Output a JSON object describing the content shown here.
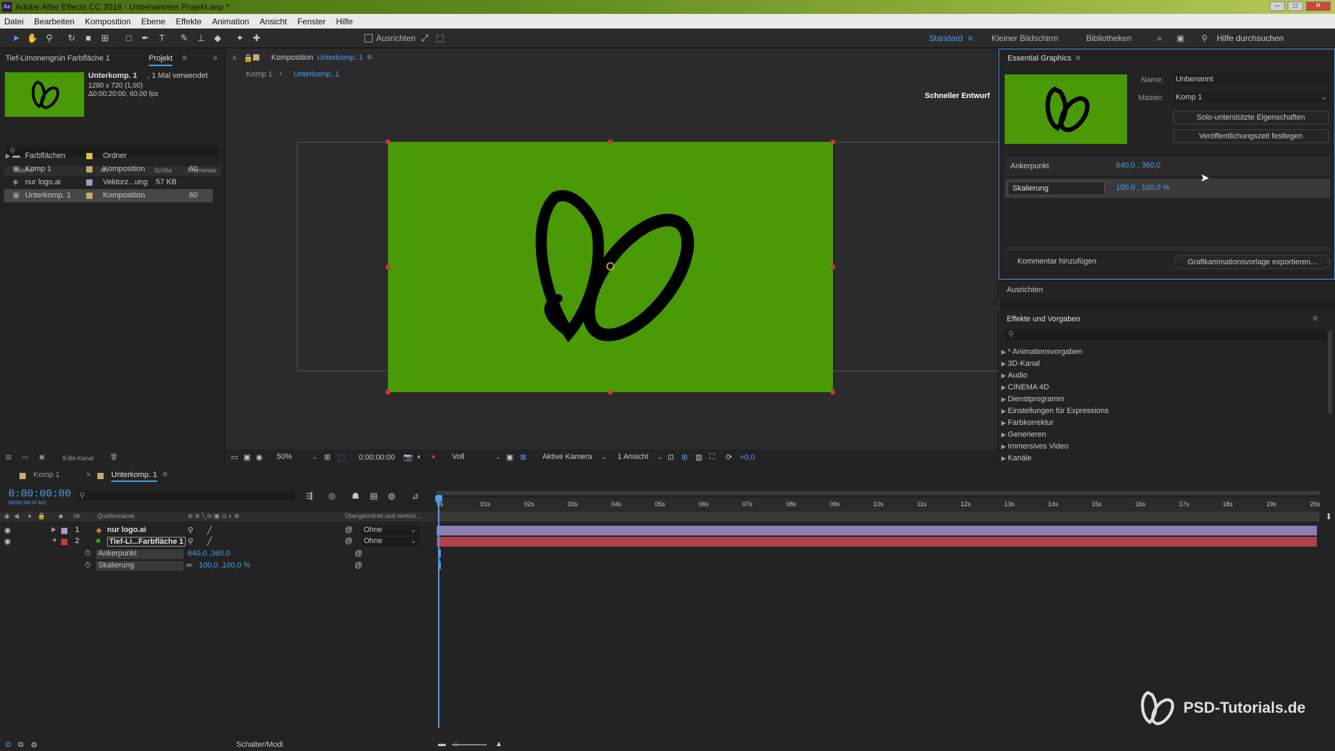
{
  "window": {
    "title": "Adobe After Effects CC 2018 - Unbenanntes Projekt.aep *",
    "app_icon": "Ae"
  },
  "menu": [
    "Datei",
    "Bearbeiten",
    "Komposition",
    "Ebene",
    "Effekte",
    "Animation",
    "Ansicht",
    "Fenster",
    "Hilfe"
  ],
  "toolbar": {
    "align_label": "Ausrichten",
    "workspaces": [
      "Standard",
      "Kleiner Bildschirm",
      "Bibliotheken"
    ],
    "search_placeholder": "Hilfe durchsuchen"
  },
  "project": {
    "effect_header": "Tief-Limonengrün Farbfläche 1",
    "tab": "Projekt",
    "info_name": "Unterkomp. 1",
    "info_usage": ", 1 Mal verwendet",
    "info_size": "1280 x 720 (1,00)",
    "info_duration": "Δ0:00:20:00, 60,00 fps",
    "columns": [
      "Name",
      "Art",
      "Größe",
      "Framerate"
    ],
    "items": [
      {
        "name": "Farbflächen",
        "type": "Ordner",
        "size": "",
        "fps": "",
        "color": "#e0c040"
      },
      {
        "name": "Komp 1",
        "type": "Komposition",
        "size": "",
        "fps": "60",
        "color": "#c8a878"
      },
      {
        "name": "nur logo.ai",
        "type": "Vektorz...ung",
        "size": "57 KB",
        "fps": "",
        "color": "#a898c8"
      },
      {
        "name": "Unterkomp. 1",
        "type": "Komposition",
        "size": "",
        "fps": "60",
        "color": "#c8a878"
      }
    ],
    "bit_depth": "8-Bit-Kanal"
  },
  "composition": {
    "tab_prefix": "Komposition",
    "tab_name": "Unterkomp. 1",
    "breadcrumb": [
      "Komp 1",
      "Unterkomp. 1"
    ],
    "draft_label": "Schneller Entwurf",
    "zoom": "50%",
    "timecode": "0:00:00:00",
    "resolution": "Voll",
    "camera": "Aktive Kamera",
    "views": "1 Ansicht",
    "exposure": "+0,0",
    "canvas_color": "#4a9a08"
  },
  "essential_graphics": {
    "title": "Essential Graphics",
    "name_label": "Name:",
    "name_value": "Unbenannt",
    "master_label": "Master:",
    "master_value": "Komp 1",
    "solo_button": "Solo-unterstützte Eigenschaften",
    "poster_button": "Veröffentlichungszeit festlegen",
    "props": [
      {
        "label": "Ankerpunkt",
        "value": "640,0 , 360,0"
      },
      {
        "label": "Skalierung",
        "value": "100,0 , 100,0 %"
      }
    ],
    "comment_button": "Kommentar hinzufügen",
    "export_button": "Grafikanimationsvorlage exportieren..."
  },
  "align_panel": {
    "title": "Ausrichten"
  },
  "effects_panel": {
    "title": "Effekte und Vorgaben",
    "items": [
      "* Animationsvorgaben",
      "3D-Kanal",
      "Audio",
      "CINEMA 4D",
      "Dienstprogramm",
      "Einstellungen für Expressions",
      "Farbkorrektur",
      "Generieren",
      "Immersives Video",
      "Kanäle"
    ]
  },
  "timeline": {
    "tabs": [
      "Komp 1",
      "Unterkomp. 1"
    ],
    "timecode": "0:00:00:00",
    "timecode_sub": "00000 (60,00 fps)",
    "col_nr": "Nr.",
    "col_source": "Quellenname",
    "col_parent": "Übergeordnet und verknü...",
    "layers": [
      {
        "nr": "1",
        "name": "nur logo.ai",
        "parent": "Ohne",
        "color": "#a898c8"
      },
      {
        "nr": "2",
        "name": "Tief-Li...Farbfläche 1",
        "parent": "Ohne",
        "color": "#c93a3a"
      }
    ],
    "props": [
      {
        "label": "Ankerpunkt",
        "value": "640,0 ,360,0"
      },
      {
        "label": "Skalierung",
        "value": "100,0 ,100,0 %"
      }
    ],
    "ruler": [
      "0s",
      "01s",
      "02s",
      "03s",
      "04s",
      "05s",
      "06s",
      "07s",
      "08s",
      "09s",
      "10s",
      "11s",
      "12s",
      "13s",
      "14s",
      "15s",
      "16s",
      "17s",
      "18s",
      "19s",
      "20s"
    ],
    "footer_label": "Schalter/Modi"
  },
  "watermark": "PSD-Tutorials.de"
}
